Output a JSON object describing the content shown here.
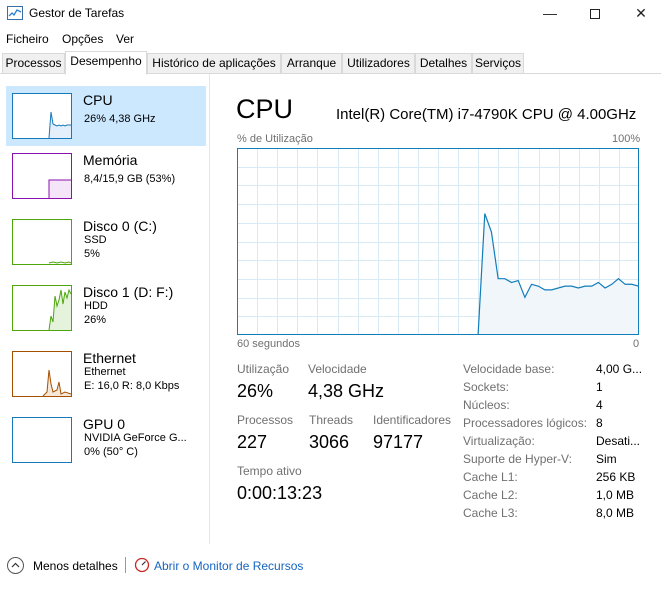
{
  "window": {
    "title": "Gestor de Tarefas"
  },
  "menu": [
    "Ficheiro",
    "Opções",
    "Ver"
  ],
  "tabs": [
    "Processos",
    "Desempenho",
    "Histórico de aplicações",
    "Arranque",
    "Utilizadores",
    "Detalhes",
    "Serviços"
  ],
  "active_tab": "Desempenho",
  "resources": [
    {
      "name": "CPU",
      "line1": "26% 4,38 GHz",
      "line2": "",
      "line3": "",
      "color": "#1779ba",
      "selected": true
    },
    {
      "name": "Memória",
      "line1": "8,4/15,9 GB (53%)",
      "line2": "",
      "line3": "",
      "color": "#8b12ae"
    },
    {
      "name": "Disco 0 (C:)",
      "line1": "SSD",
      "line2": "5%",
      "line3": "",
      "color": "#4da60c"
    },
    {
      "name": "Disco 1 (D: F:)",
      "line1": "HDD",
      "line2": "26%",
      "line3": "",
      "color": "#4da60c"
    },
    {
      "name": "Ethernet",
      "line1": "Ethernet",
      "line2": "E: 16,0  R: 8,0 Kbps",
      "line3": "",
      "color": "#a74f01"
    },
    {
      "name": "GPU 0",
      "line1": "NVIDIA GeForce G...",
      "line2": "0% (50° C)",
      "line3": "",
      "color": "#1779ba"
    }
  ],
  "main": {
    "title": "CPU",
    "processor": "Intel(R) Core(TM) i7-4790K CPU @ 4.00GHz",
    "graph_top_left": "% de Utilização",
    "graph_top_right": "100%",
    "graph_bottom_left": "60 segundos",
    "graph_bottom_right": "0"
  },
  "stats": {
    "utilization_label": "Utilização",
    "utilization_value": "26%",
    "speed_label": "Velocidade",
    "speed_value": "4,38 GHz",
    "processes_label": "Processos",
    "processes_value": "227",
    "threads_label": "Threads",
    "threads_value": "3066",
    "handles_label": "Identificadores",
    "handles_value": "97177",
    "uptime_label": "Tempo ativo",
    "uptime_value": "0:00:13:23"
  },
  "details": [
    {
      "label": "Velocidade base:",
      "value": "4,00 G..."
    },
    {
      "label": "Sockets:",
      "value": "1"
    },
    {
      "label": "Núcleos:",
      "value": "4"
    },
    {
      "label": "Processadores lógicos:",
      "value": "8"
    },
    {
      "label": "Virtualização:",
      "value": "Desati..."
    },
    {
      "label": "Suporte de Hyper-V:",
      "value": "Sim"
    },
    {
      "label": "Cache L1:",
      "value": "256 KB"
    },
    {
      "label": "Cache L2:",
      "value": "1,0 MB"
    },
    {
      "label": "Cache L3:",
      "value": "8,0 MB"
    }
  ],
  "chart_data": {
    "type": "area",
    "title": "",
    "xlabel": "60 segundos",
    "ylabel": "% de Utilização",
    "x": [
      60,
      59,
      58,
      57,
      56,
      55,
      54,
      53,
      52,
      51,
      50,
      49,
      48,
      47,
      46,
      45,
      44,
      43,
      42,
      41,
      40,
      39,
      38,
      37,
      36,
      35,
      34,
      33,
      32,
      31,
      30,
      29,
      28,
      27,
      26,
      25,
      24,
      23,
      22,
      21,
      20,
      19,
      18,
      17,
      16,
      15,
      14,
      13,
      12,
      11,
      10,
      9,
      8,
      7,
      6,
      5,
      4,
      3,
      2,
      1,
      0
    ],
    "series": [
      {
        "values": [
          null,
          null,
          null,
          null,
          null,
          null,
          null,
          null,
          null,
          null,
          null,
          null,
          null,
          null,
          null,
          null,
          null,
          null,
          null,
          null,
          null,
          null,
          null,
          null,
          null,
          null,
          null,
          null,
          null,
          null,
          null,
          null,
          null,
          null,
          null,
          null,
          0,
          65,
          55,
          30,
          30,
          28,
          29,
          20,
          27,
          26,
          24,
          24,
          25,
          26,
          26,
          25,
          26,
          26,
          28,
          25,
          27,
          30,
          27,
          27,
          26
        ]
      }
    ],
    "ylim": [
      0,
      100
    ],
    "xlim": [
      60,
      0
    ],
    "grid": true,
    "color": "#117dbb"
  },
  "bottom": {
    "less_details": "Menos detalhes",
    "resource_monitor": "Abrir o Monitor de Recursos"
  }
}
